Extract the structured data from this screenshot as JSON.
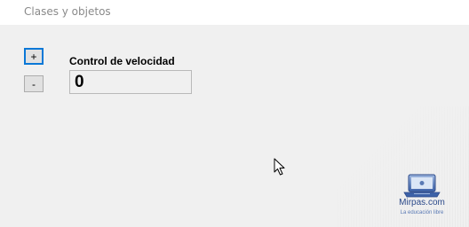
{
  "window": {
    "title": "Clases y objetos"
  },
  "controls": {
    "increase_label": "+",
    "decrease_label": "-"
  },
  "speed": {
    "label": "Control de velocidad",
    "value": "0"
  },
  "watermark": {
    "name": "Mirpas.com",
    "tagline": "La educación libre"
  },
  "colors": {
    "window_background": "#f0f0f0",
    "titlebar_background": "#ffffff",
    "focus_border": "#0a78d7",
    "button_face": "#e1e1e1",
    "watermark_text": "#2c4a8a"
  },
  "icons": {
    "cursor": "arrow-cursor-icon",
    "watermark_logo": "laptop-logo-icon"
  }
}
